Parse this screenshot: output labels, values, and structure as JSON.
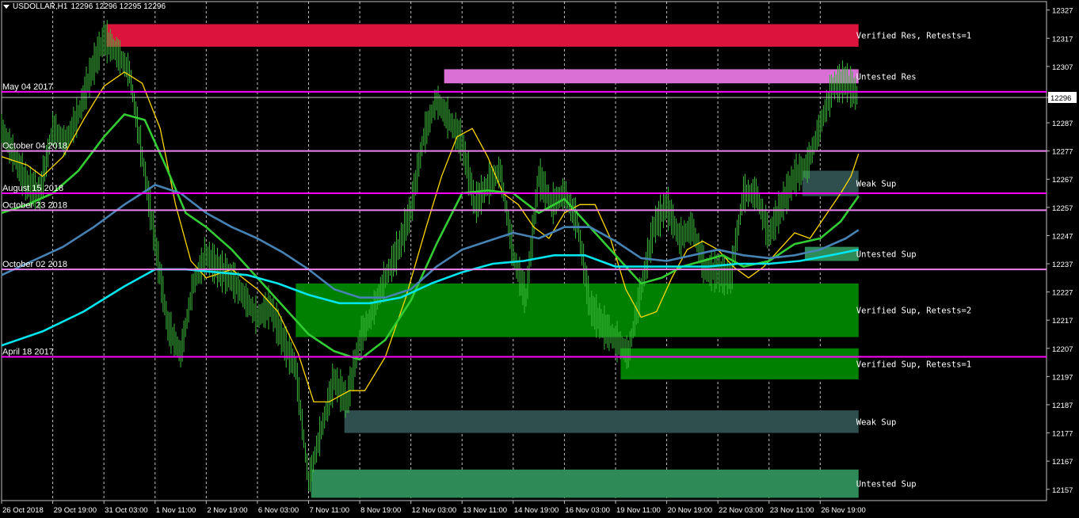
{
  "header": {
    "symbol": "USDOLLAR,H1",
    "ohlc": "12296 12296 12295 12296"
  },
  "chart_data": {
    "type": "line",
    "title": "USDOLLAR,H1",
    "price_axis": {
      "ticks": [
        12327,
        12317,
        12307,
        12296,
        12287,
        12277,
        12267,
        12257,
        12247,
        12237,
        12227,
        12217,
        12207,
        12197,
        12187,
        12177,
        12167,
        12157
      ],
      "current_price": 12296,
      "ylim": [
        12153,
        12330
      ]
    },
    "time_axis": {
      "labels": [
        "26 Oct 2018",
        "29 Oct 19:00",
        "31 Oct 03:00",
        "1 Nov 11:00",
        "2 Nov 19:00",
        "6 Nov 03:00",
        "7 Nov 11:00",
        "8 Nov 19:00",
        "12 Nov 03:00",
        "13 Nov 11:00",
        "14 Nov 19:00",
        "16 Nov 03:00",
        "19 Nov 11:00",
        "20 Nov 19:00",
        "22 Nov 03:00",
        "23 Nov 11:00",
        "26 Nov 19:00"
      ],
      "xlim": [
        0,
        16.8
      ]
    },
    "zones": [
      {
        "label": "Verified Res, Retests=1",
        "x0": 2.05,
        "x1": 16.75,
        "low": 12314,
        "high": 12322,
        "color": "#dc143c"
      },
      {
        "label": "Untested Res",
        "x0": 8.65,
        "x1": 16.75,
        "low": 12301,
        "high": 12306,
        "color": "#da70d6"
      },
      {
        "label": "Weak Sup",
        "x0": 15.65,
        "x1": 16.75,
        "low": 12261,
        "high": 12270,
        "color": "#2f4f4f"
      },
      {
        "label": "Untested Sup",
        "x0": 15.7,
        "x1": 16.75,
        "low": 12238,
        "high": 12243,
        "color": "#2e8b57"
      },
      {
        "label": "Verified Sup, Retests=2",
        "x0": 5.75,
        "x1": 16.75,
        "low": 12211,
        "high": 12230,
        "color": "#008000"
      },
      {
        "label": "Verified Sup, Retests=1",
        "x0": 12.1,
        "x1": 16.75,
        "low": 12196,
        "high": 12207,
        "color": "#008000"
      },
      {
        "label": "Weak Sup",
        "x0": 6.7,
        "x1": 16.75,
        "low": 12177,
        "high": 12185,
        "color": "#2f4f4f"
      },
      {
        "label": "Untested Sup",
        "x0": 6.05,
        "x1": 16.75,
        "low": 12154,
        "high": 12164,
        "color": "#2e8b57"
      }
    ],
    "levels": [
      {
        "label": "May 04 2017",
        "price": 12298,
        "color": "#ff00ff"
      },
      {
        "label": "October 04 2018",
        "price": 12277,
        "color": "#ee82ee"
      },
      {
        "label": "August 15 2018",
        "price": 12262,
        "color": "#ff00ff"
      },
      {
        "label": "October 23 2018",
        "price": 12256,
        "color": "#ee82ee"
      },
      {
        "label": "October 02 2018",
        "price": 12235,
        "color": "#ee82ee"
      },
      {
        "label": "April 18 2017",
        "price": 12204,
        "color": "#ff00ff"
      }
    ],
    "price_series": {
      "name": "",
      "color": "#3cb93c",
      "x": [
        0,
        0.25,
        0.5,
        0.75,
        1.0,
        1.25,
        1.5,
        1.75,
        2.0,
        2.25,
        2.5,
        2.75,
        3.0,
        3.25,
        3.5,
        3.75,
        4.0,
        4.25,
        4.5,
        4.75,
        5.0,
        5.25,
        5.5,
        5.75,
        6.0,
        6.25,
        6.5,
        6.75,
        7.0,
        7.25,
        7.5,
        7.75,
        8.0,
        8.25,
        8.5,
        8.75,
        9.0,
        9.25,
        9.5,
        9.75,
        10.0,
        10.25,
        10.5,
        10.75,
        11.0,
        11.25,
        11.5,
        11.75,
        12.0,
        12.25,
        12.5,
        12.75,
        13.0,
        13.25,
        13.5,
        13.75,
        14.0,
        14.25,
        14.5,
        14.75,
        15.0,
        15.25,
        15.5,
        15.75,
        16.0,
        16.25,
        16.5,
        16.75
      ],
      "values": [
        12285,
        12275,
        12265,
        12262,
        12285,
        12280,
        12290,
        12305,
        12317,
        12312,
        12305,
        12275,
        12245,
        12215,
        12205,
        12230,
        12240,
        12235,
        12232,
        12225,
        12218,
        12222,
        12210,
        12200,
        12160,
        12178,
        12196,
        12188,
        12210,
        12220,
        12232,
        12242,
        12256,
        12282,
        12295,
        12288,
        12280,
        12258,
        12265,
        12270,
        12240,
        12225,
        12268,
        12258,
        12262,
        12252,
        12222,
        12215,
        12210,
        12205,
        12228,
        12250,
        12258,
        12246,
        12250,
        12235,
        12234,
        12232,
        12262,
        12262,
        12247,
        12258,
        12268,
        12272,
        12286,
        12300,
        12302,
        12296
      ]
    },
    "moving_averages": [
      {
        "color": "#ffd700",
        "x": [
          0,
          0.5,
          0.8,
          1.2,
          1.6,
          2.0,
          2.4,
          2.75,
          3.1,
          3.4,
          3.7,
          4.0,
          4.5,
          5.0,
          5.4,
          5.8,
          6.1,
          6.4,
          6.8,
          7.1,
          7.5,
          7.9,
          8.3,
          8.6,
          8.9,
          9.2,
          9.5,
          9.8,
          10.1,
          10.4,
          10.7,
          11.0,
          11.3,
          11.6,
          11.9,
          12.2,
          12.5,
          12.8,
          13.1,
          13.4,
          13.7,
          14.0,
          14.3,
          14.6,
          14.9,
          15.2,
          15.5,
          15.8,
          16.1,
          16.4,
          16.6,
          16.75
        ],
        "values": [
          12275,
          12272,
          12268,
          12275,
          12288,
          12300,
          12305,
          12301,
          12285,
          12258,
          12238,
          12232,
          12235,
          12228,
          12220,
          12205,
          12188,
          12188,
          12192,
          12192,
          12204,
          12225,
          12250,
          12268,
          12282,
          12285,
          12275,
          12262,
          12258,
          12250,
          12246,
          12255,
          12258,
          12258,
          12246,
          12228,
          12218,
          12220,
          12232,
          12242,
          12245,
          12242,
          12236,
          12232,
          12236,
          12242,
          12248,
          12246,
          12254,
          12262,
          12268,
          12276
        ]
      },
      {
        "color": "#32cd32",
        "x": [
          0,
          0.5,
          1.0,
          1.5,
          2.0,
          2.4,
          2.8,
          3.2,
          3.6,
          4.0,
          4.5,
          5.0,
          5.5,
          6.0,
          6.5,
          7.0,
          7.5,
          8.0,
          8.5,
          9.0,
          9.5,
          10.0,
          10.5,
          11.0,
          11.5,
          12.0,
          12.5,
          12.9,
          13.3,
          13.7,
          14.1,
          14.5,
          15.0,
          15.5,
          16.0,
          16.4,
          16.75
        ],
        "values": [
          12255,
          12258,
          12262,
          12270,
          12282,
          12290,
          12288,
          12272,
          12255,
          12250,
          12242,
          12232,
          12222,
          12212,
          12206,
          12203,
          12210,
          12224,
          12244,
          12262,
          12263,
          12262,
          12255,
          12260,
          12250,
          12240,
          12230,
          12232,
          12236,
          12238,
          12240,
          12236,
          12238,
          12244,
          12246,
          12252,
          12261
        ]
      },
      {
        "color": "#4682b4",
        "x": [
          0,
          0.6,
          1.2,
          1.8,
          2.4,
          3.0,
          3.5,
          4.0,
          4.5,
          5.0,
          5.5,
          6.0,
          6.5,
          7.0,
          7.5,
          8.0,
          8.5,
          9.0,
          9.5,
          10.0,
          10.5,
          11.0,
          11.5,
          12.0,
          12.5,
          13.0,
          13.5,
          14.0,
          14.5,
          15.0,
          15.5,
          16.0,
          16.5,
          16.75
        ],
        "values": [
          12233,
          12238,
          12243,
          12250,
          12258,
          12265,
          12262,
          12255,
          12250,
          12246,
          12241,
          12235,
          12228,
          12225,
          12225,
          12228,
          12236,
          12242,
          12245,
          12248,
          12246,
          12250,
          12250,
          12245,
          12239,
          12238,
          12240,
          12242,
          12240,
          12239,
          12240,
          12242,
          12246,
          12249
        ]
      },
      {
        "color": "#00e5ee",
        "x": [
          0,
          0.8,
          1.6,
          2.4,
          3.0,
          3.6,
          4.2,
          4.8,
          5.4,
          6.0,
          6.6,
          7.2,
          7.8,
          8.4,
          9.0,
          9.6,
          10.2,
          10.8,
          11.4,
          12.0,
          12.6,
          13.2,
          13.8,
          14.4,
          15.0,
          15.6,
          16.2,
          16.75
        ],
        "values": [
          12208,
          12213,
          12220,
          12229,
          12235,
          12235,
          12234,
          12233,
          12230,
          12226,
          12223,
          12223,
          12225,
          12230,
          12234,
          12237,
          12238,
          12240,
          12240,
          12236,
          12236,
          12236,
          12236,
          12237,
          12237,
          12238,
          12240,
          12242
        ]
      }
    ],
    "grid": "vertical dashed",
    "legend": "none"
  }
}
